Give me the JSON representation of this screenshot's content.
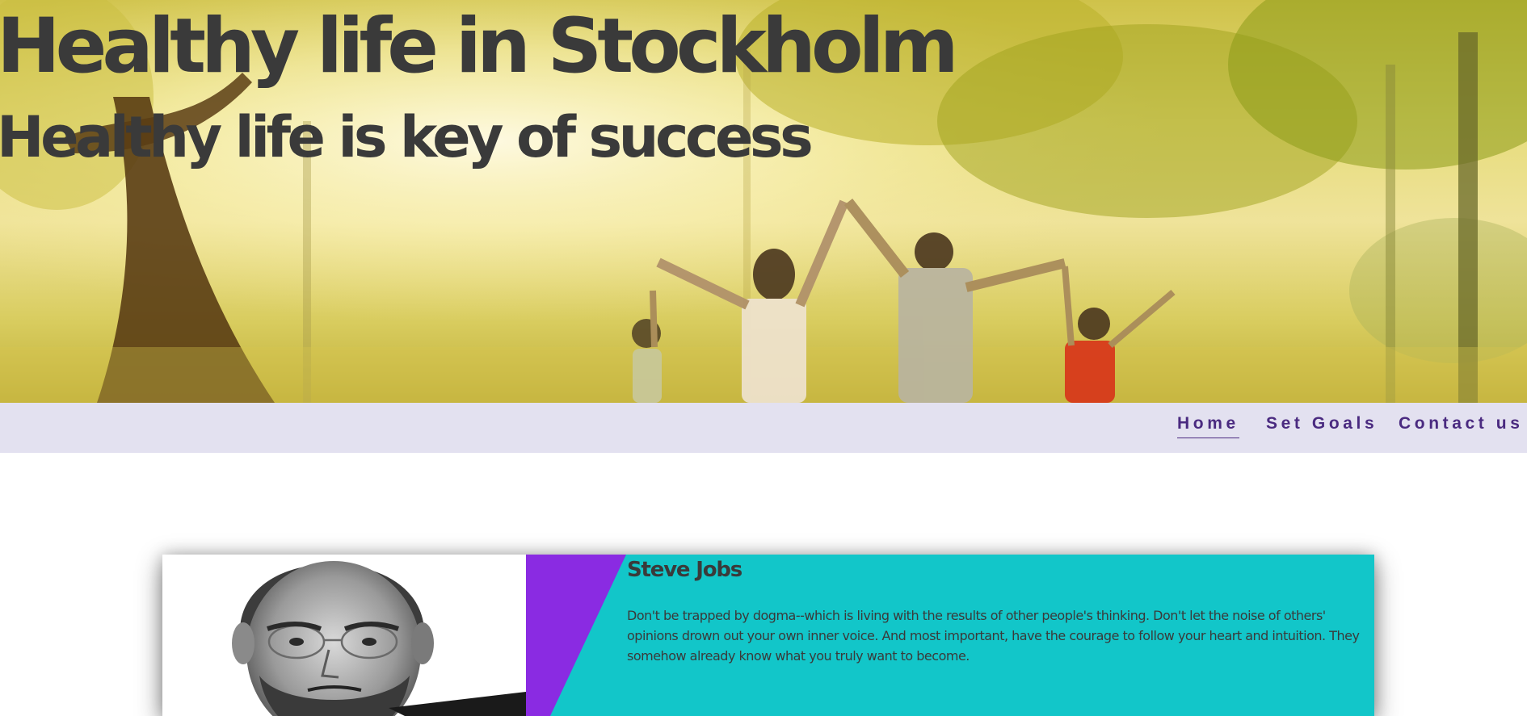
{
  "hero": {
    "title": "Healthy life in Stockholm",
    "subtitle": "Healthy life is key of success"
  },
  "nav": {
    "items": [
      {
        "label": "Home",
        "active": true
      },
      {
        "label": "Set Goals",
        "active": false
      },
      {
        "label": "Contact us",
        "active": false
      }
    ]
  },
  "quote_card": {
    "name": "Steve Jobs",
    "text": "Don't be trapped by dogma--which is living with the results of other people's thinking. Don't let the noise of others' opinions drown out your own inner voice. And most important, have the courage to follow your heart and intuition. They somehow already know what you truly want to become."
  },
  "colors": {
    "heading_text": "#3a3a3a",
    "nav_background": "#e3e1f0",
    "nav_link": "#4a2a80",
    "card_teal": "#12c6c9",
    "card_purple": "#8a2be2"
  }
}
